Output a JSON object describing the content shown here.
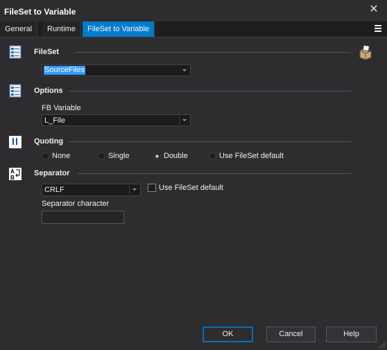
{
  "window": {
    "title": "FileSet to Variable"
  },
  "tabs": [
    {
      "label": "General"
    },
    {
      "label": "Runtime"
    },
    {
      "label": "FileSet to Variable"
    }
  ],
  "fileset": {
    "title": "FileSet",
    "value": "SourceFiles"
  },
  "options": {
    "title": "Options",
    "fb_variable_label": "FB Variable",
    "fb_variable_value": "L_File"
  },
  "quoting": {
    "title": "Quoting",
    "options": [
      "None",
      "Single",
      "Double",
      "Use FileSet default"
    ],
    "selected": "Double"
  },
  "separator": {
    "title": "Separator",
    "value": "CRLF",
    "use_default_label": "Use FileSet default",
    "use_default_checked": false,
    "char_label": "Separator character",
    "char_value": ""
  },
  "buttons": {
    "ok": "OK",
    "cancel": "Cancel",
    "help": "Help"
  },
  "colors": {
    "background": "#2d2d30",
    "active_tab": "#007acc",
    "selection": "#3399ff"
  }
}
